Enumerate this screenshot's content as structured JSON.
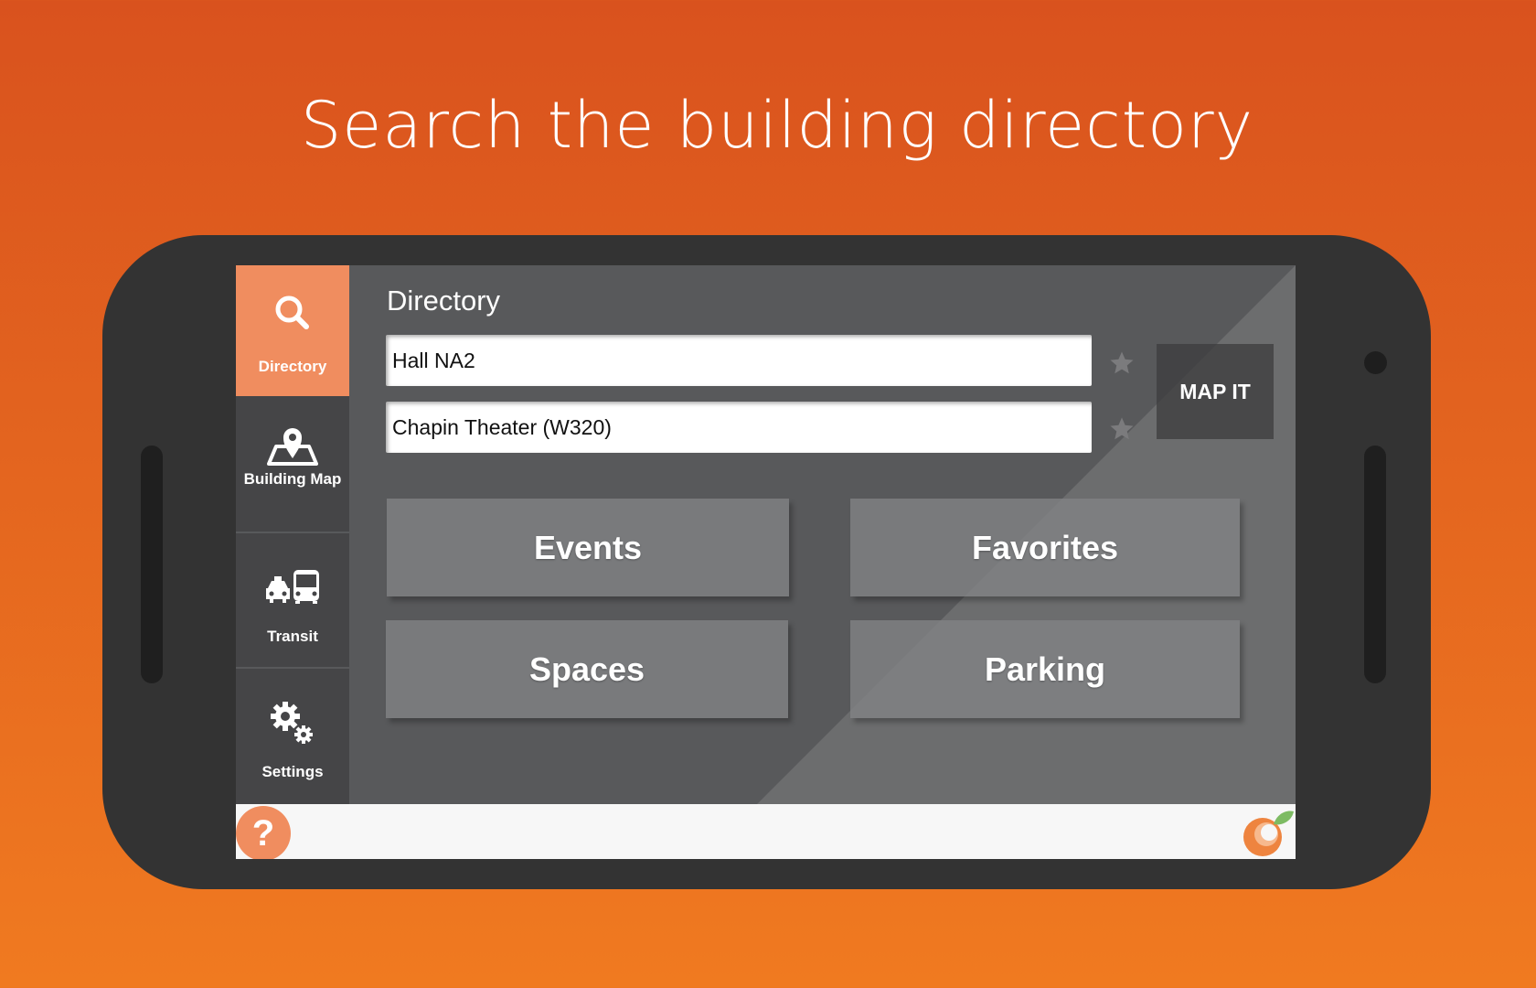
{
  "headline": "Search the building directory",
  "sidebar": {
    "items": [
      {
        "label": "Directory",
        "icon": "search-icon",
        "active": true
      },
      {
        "label": "Building Map",
        "icon": "map-pin-icon",
        "active": false
      },
      {
        "label": "Transit",
        "icon": "taxi-bus-icon",
        "active": false
      },
      {
        "label": "Settings",
        "icon": "gears-icon",
        "active": false
      }
    ]
  },
  "main": {
    "title": "Directory",
    "from_value": "Hall NA2",
    "to_value": "Chapin Theater (W320)",
    "map_it_label": "MAP IT",
    "tiles": [
      "Events",
      "Favorites",
      "Spaces",
      "Parking"
    ]
  },
  "bottom": {
    "help_label": "?",
    "logo": "orange-leaf-logo"
  },
  "colors": {
    "accent": "#f08d5f",
    "background_top": "#d9521e",
    "background_bottom": "#f07a20",
    "phone_body": "#333333"
  }
}
